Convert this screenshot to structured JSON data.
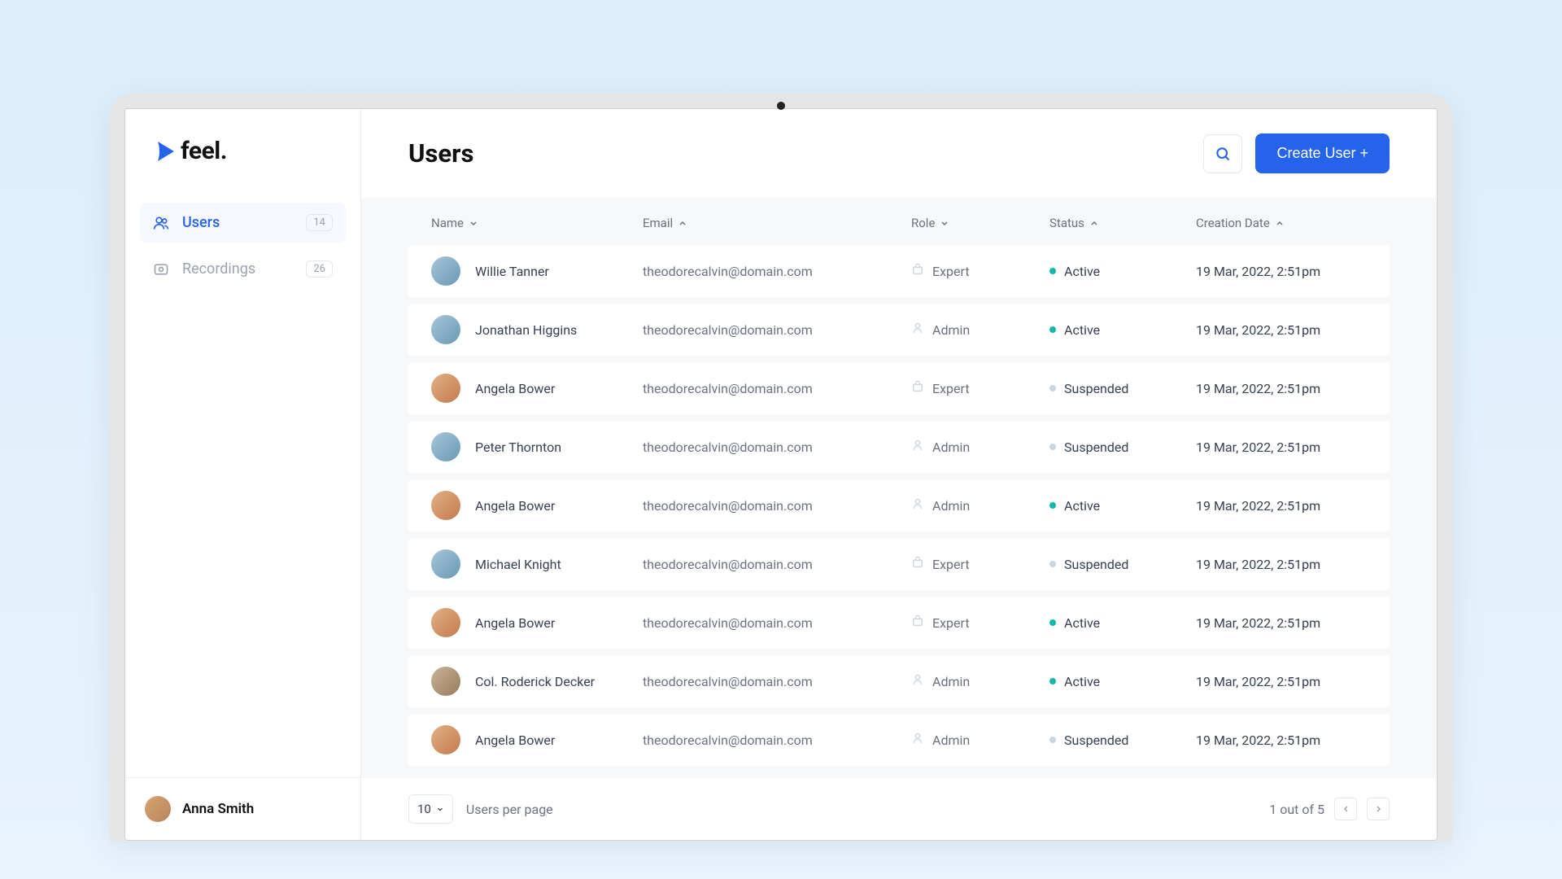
{
  "brand": {
    "name": "feel."
  },
  "sidebar": {
    "items": [
      {
        "label": "Users",
        "badge": "14",
        "active": true
      },
      {
        "label": "Recordings",
        "badge": "26",
        "active": false
      }
    ],
    "footer_user": "Anna Smith"
  },
  "header": {
    "title": "Users",
    "create_label": "Create User +"
  },
  "table": {
    "columns": {
      "name": "Name",
      "email": "Email",
      "role": "Role",
      "status": "Status",
      "creation": "Creation Date"
    },
    "rows": [
      {
        "name": "Willie Tanner",
        "email": "theodorecalvin@domain.com",
        "role": "Expert",
        "status": "Active",
        "date": "19 Mar, 2022, 2:51pm",
        "av": "v2"
      },
      {
        "name": "Jonathan Higgins",
        "email": "theodorecalvin@domain.com",
        "role": "Admin",
        "status": "Active",
        "date": "19 Mar, 2022, 2:51pm",
        "av": "v2"
      },
      {
        "name": "Angela Bower",
        "email": "theodorecalvin@domain.com",
        "role": "Expert",
        "status": "Suspended",
        "date": "19 Mar, 2022, 2:51pm",
        "av": "v3"
      },
      {
        "name": "Peter Thornton",
        "email": "theodorecalvin@domain.com",
        "role": "Admin",
        "status": "Suspended",
        "date": "19 Mar, 2022, 2:51pm",
        "av": "v2"
      },
      {
        "name": "Angela Bower",
        "email": "theodorecalvin@domain.com",
        "role": "Admin",
        "status": "Active",
        "date": "19 Mar, 2022, 2:51pm",
        "av": "v3"
      },
      {
        "name": "Michael Knight",
        "email": "theodorecalvin@domain.com",
        "role": "Expert",
        "status": "Suspended",
        "date": "19 Mar, 2022, 2:51pm",
        "av": "v2"
      },
      {
        "name": "Angela Bower",
        "email": "theodorecalvin@domain.com",
        "role": "Expert",
        "status": "Active",
        "date": "19 Mar, 2022, 2:51pm",
        "av": "v3"
      },
      {
        "name": "Col. Roderick Decker",
        "email": "theodorecalvin@domain.com",
        "role": "Admin",
        "status": "Active",
        "date": "19 Mar, 2022, 2:51pm",
        "av": ""
      },
      {
        "name": "Angela Bower",
        "email": "theodorecalvin@domain.com",
        "role": "Admin",
        "status": "Suspended",
        "date": "19 Mar, 2022, 2:51pm",
        "av": "v3"
      }
    ]
  },
  "pagination": {
    "page_size": "10",
    "page_size_label": "Users per page",
    "page_info": "1 out of 5"
  }
}
